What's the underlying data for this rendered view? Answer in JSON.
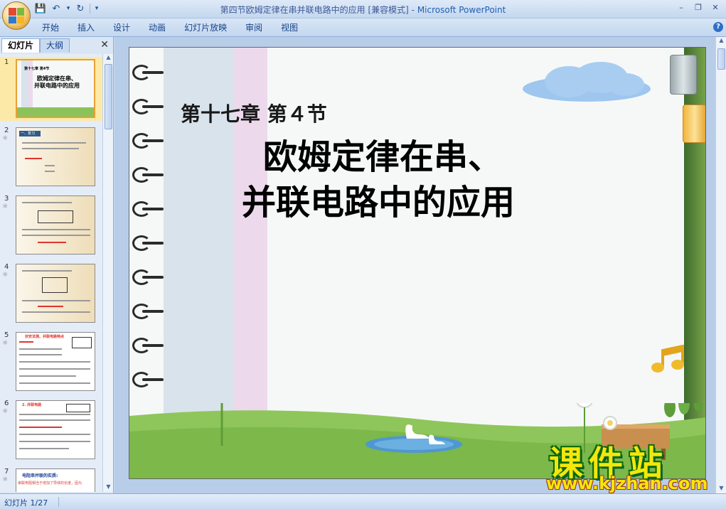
{
  "window": {
    "title_doc": "第四节欧姆定律在串并联电路中的应用 [兼容模式]",
    "title_sep": " - ",
    "title_app": "Microsoft PowerPoint",
    "minimize": "–",
    "restore": "❐",
    "close": "✕"
  },
  "qat": {
    "save": "💾",
    "undo": "↶",
    "redo": "↻",
    "dropdown": "▾"
  },
  "ribbon": {
    "tabs": [
      "开始",
      "插入",
      "设计",
      "动画",
      "幻灯片放映",
      "审阅",
      "视图"
    ],
    "help": "?"
  },
  "left_panel": {
    "tab_slides": "幻灯片",
    "tab_outline": "大纲",
    "close": "✕",
    "thumbnails": [
      {
        "num": "1",
        "anim": "",
        "line1": "第十七章 第4节",
        "line2": "欧姆定律在串、",
        "line3": "并联电路中的应用"
      },
      {
        "num": "2",
        "anim": "☼",
        "head": "一、复习"
      },
      {
        "num": "3",
        "anim": "☼"
      },
      {
        "num": "4",
        "anim": "☼"
      },
      {
        "num": "5",
        "anim": "☼",
        "head": "伏安法测、并联电路特点"
      },
      {
        "num": "6",
        "anim": "☼",
        "head": "2. 并联电路"
      },
      {
        "num": "7",
        "anim": "☼",
        "head": "电阻串并联的实质:",
        "line2": "串联电阻相当于增加了导体的长度，因为"
      }
    ]
  },
  "slide": {
    "chapter": "第十七章 第４节",
    "title_line1": "欧姆定律在串、",
    "title_line2": "并联电路中的应用"
  },
  "watermark": {
    "cn": "课件站",
    "url": "www.kjzhan.com"
  },
  "status": {
    "slide_counter": "幻灯片 1/27"
  },
  "colors": {
    "accent": "#15428b",
    "ribbon_bg": "#c3d7ef",
    "watermark_yellow": "#f5e60c"
  }
}
